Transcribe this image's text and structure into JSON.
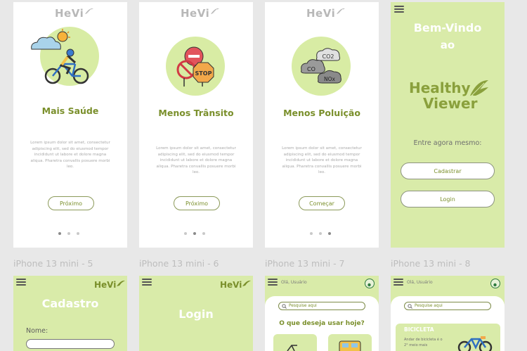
{
  "brand": {
    "short": "HeVi",
    "full_line1": "Healthy",
    "full_line2": "Viewer"
  },
  "onboarding": [
    {
      "title": "Mais Saúde",
      "button": "Próximo",
      "illustration": "cyclist-icon"
    },
    {
      "title": "Menos Trânsito",
      "button": "Próximo",
      "illustration": "stop-sign-icon"
    },
    {
      "title": "Menos Poluição",
      "button": "Começar",
      "illustration": "co2-clouds-icon"
    }
  ],
  "lorem": "Lorem ipsum dolor sit amet, consectetur adipiscing elit, sed do eiusmod tempor incididunt ut labore et dolore magna aliqua. Pharetra convallis posuere morbi leo.",
  "welcome": {
    "line1": "Bem-Vindo",
    "line2": "ao",
    "prompt": "Entre agora mesmo:",
    "signup_button": "Cadastrar",
    "login_button": "Login"
  },
  "frame_labels": [
    "iPhone 13 mini - 5",
    "iPhone 13 mini - 6",
    "iPhone 13 mini - 7",
    "iPhone 13 mini - 8"
  ],
  "signup": {
    "title": "Cadastro",
    "name_label": "Nome:"
  },
  "login": {
    "title": "Login"
  },
  "home": {
    "greeting": "Olá, Usuário",
    "search_placeholder": "Pesquise aqui",
    "question": "O que deseja usar hoje?"
  },
  "bike": {
    "greeting": "Olá, Usuário",
    "search_placeholder": "Pesquise aqui",
    "card_title": "BICICLETA",
    "card_text": "Andar de bicicleta é o 2° meio mais"
  },
  "colors": {
    "green_bg": "#d9eba9",
    "accent": "#7a8f2b",
    "circle": "#d8eca4"
  }
}
